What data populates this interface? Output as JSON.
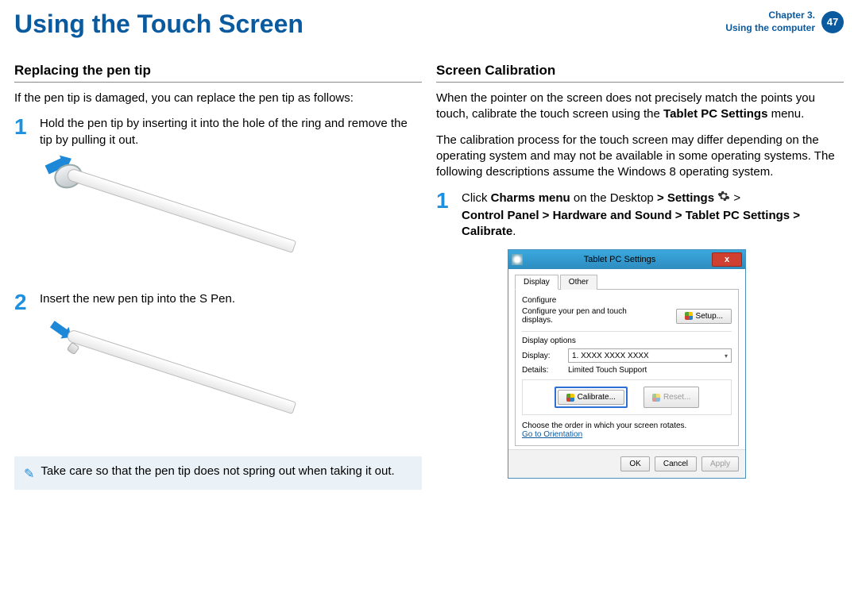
{
  "header": {
    "title": "Using the Touch Screen",
    "chapter_line1": "Chapter 3.",
    "chapter_line2": "Using the computer",
    "page_number": "47"
  },
  "left": {
    "heading": "Replacing the pen tip",
    "intro": "If the pen tip is damaged, you can replace the pen tip as follows:",
    "step1": "Hold the pen tip by inserting it into the hole of the ring and remove the tip by pulling it out.",
    "step2": "Insert the new pen tip into the S Pen.",
    "note": "Take care so that the pen tip does not spring out when taking it out."
  },
  "right": {
    "heading": "Screen Calibration",
    "p1_a": "When the pointer on the screen does not precisely match the points you touch, calibrate the touch screen using the ",
    "p1_b": "Tablet PC Settings",
    "p1_c": " menu.",
    "p2": "The calibration process for the touch screen may differ depending on the operating system and may not be available in some operating systems. The following descriptions assume the Windows 8 operating system.",
    "step1_a": "Click ",
    "step1_b": "Charms menu",
    "step1_c": " on the Desktop ",
    "step1_d": "> Settings",
    "step1_e": " > ",
    "step1_f": "Control Panel > Hardware and Sound > Tablet PC Settings > Calibrate",
    "step1_g": "."
  },
  "dialog": {
    "title": "Tablet PC Settings",
    "close": "x",
    "tabs": {
      "display": "Display",
      "other": "Other"
    },
    "configure_label": "Configure",
    "configure_desc": "Configure your pen and touch displays.",
    "setup_btn": "Setup...",
    "display_options_label": "Display options",
    "display_label": "Display:",
    "display_value": "1.  XXXX XXXX XXXX",
    "details_label": "Details:",
    "details_value": "Limited Touch Support",
    "calibrate_btn": "Calibrate...",
    "reset_btn": "Reset...",
    "orientation_text": "Choose the order in which your screen rotates.",
    "orientation_link": "Go to Orientation",
    "ok": "OK",
    "cancel": "Cancel",
    "apply": "Apply"
  }
}
